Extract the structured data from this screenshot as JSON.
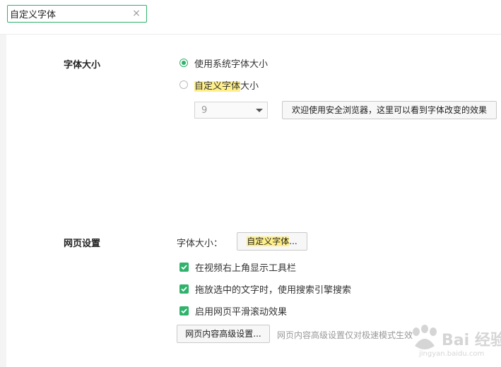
{
  "search": {
    "value": "自定义字体",
    "clear_symbol": "×"
  },
  "font_size_section": {
    "title": "字体大小",
    "option_system": "使用系统字体大小",
    "option_custom_highlight": "自定义字体",
    "option_custom_rest": "大小",
    "selected_option": "system",
    "size_value": "9",
    "preview_text": "欢迎使用安全浏览器，这里可以看到字体改变的效果"
  },
  "webpage_section": {
    "title": "网页设置",
    "font_size_label": "字体大小：",
    "custom_font_button_highlight": "自定义字体",
    "custom_font_button_rest": "...",
    "checkboxes": [
      {
        "label": "在视频右上角显示工具栏",
        "checked": true
      },
      {
        "label": "拖放选中的文字时，使用搜索引擎搜索",
        "checked": true
      },
      {
        "label": "启用网页平滑滚动效果",
        "checked": true
      }
    ],
    "advanced_button": "网页内容高级设置...",
    "advanced_note": "网页内容高级设置仅对极速模式生效"
  },
  "watermark": {
    "text": "Bai 经验",
    "url": "jingyan.baidu.com"
  },
  "colors": {
    "accent": "#2fb26b",
    "highlight": "#ffef8a"
  }
}
